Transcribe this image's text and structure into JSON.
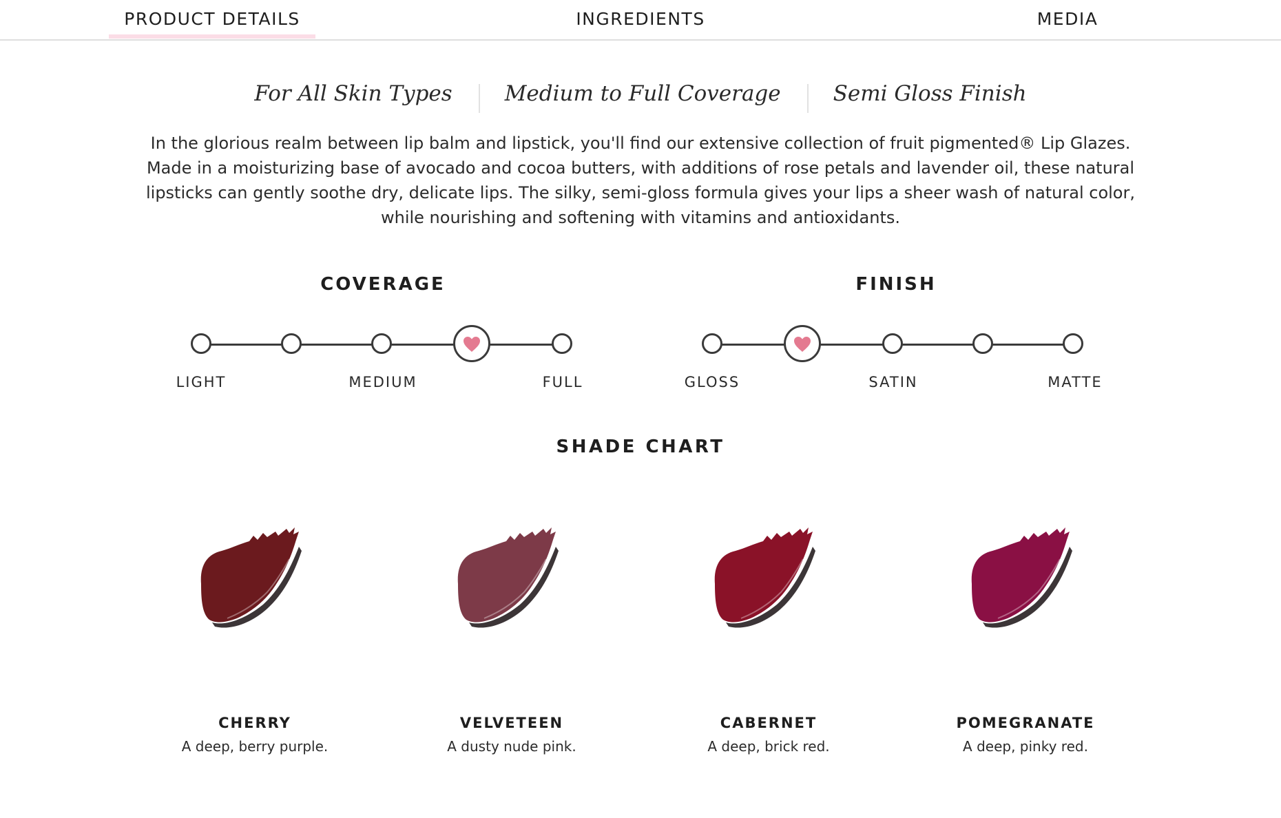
{
  "tabs": [
    {
      "label": "PRODUCT DETAILS",
      "active": true
    },
    {
      "label": "INGREDIENTS",
      "active": false
    },
    {
      "label": "MEDIA",
      "active": false
    }
  ],
  "attributes": [
    "For All Skin Types",
    "Medium to Full Coverage",
    "Semi Gloss Finish"
  ],
  "description": "In the glorious realm between lip balm and lipstick, you'll find our extensive collection of fruit pigmented® Lip Glazes. Made in a moisturizing base of avocado and cocoa butters, with additions of rose petals and lavender oil, these natural lipsticks can gently soothe dry, delicate lips. The silky, semi-gloss formula gives your lips a sheer wash of natural color, while nourishing and softening with vitamins and antioxidants.",
  "coverage": {
    "title": "COVERAGE",
    "steps": 5,
    "selected_index": 3,
    "labels": [
      "LIGHT",
      "MEDIUM",
      "FULL"
    ]
  },
  "finish": {
    "title": "FINISH",
    "steps": 5,
    "selected_index": 1,
    "labels": [
      "GLOSS",
      "SATIN",
      "MATTE"
    ]
  },
  "colors": {
    "heart": "#e47a90",
    "tab_underline": "#fbdde6"
  },
  "shade_chart": {
    "title": "SHADE CHART",
    "shades": [
      {
        "name": "CHERRY",
        "description": "A deep, berry purple.",
        "color": "#6b1a1e"
      },
      {
        "name": "VELVETEEN",
        "description": "A dusty nude pink.",
        "color": "#7d3a48"
      },
      {
        "name": "CABERNET",
        "description": "A deep, brick red.",
        "color": "#8a1228"
      },
      {
        "name": "POMEGRANATE",
        "description": "A deep, pinky red.",
        "color": "#8a1044"
      }
    ]
  }
}
